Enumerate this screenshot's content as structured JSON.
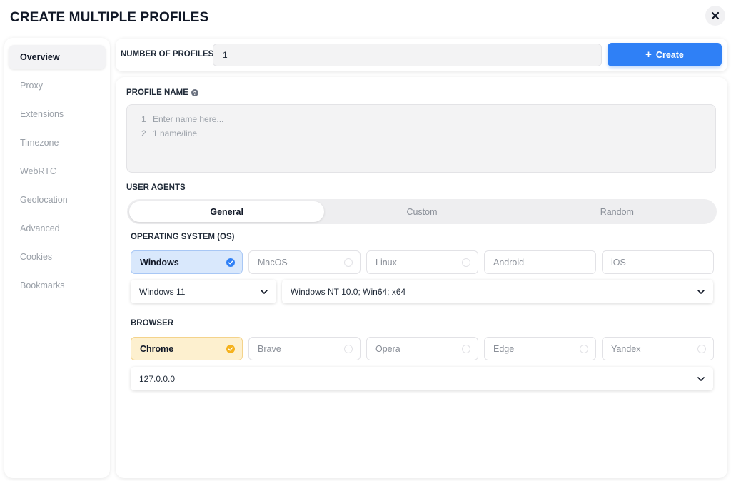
{
  "dialog": {
    "title": "CREATE MULTIPLE PROFILES"
  },
  "sidebar": {
    "items": [
      {
        "label": "Overview",
        "active": true
      },
      {
        "label": "Proxy"
      },
      {
        "label": "Extensions"
      },
      {
        "label": "Timezone"
      },
      {
        "label": "WebRTC"
      },
      {
        "label": "Geolocation"
      },
      {
        "label": "Advanced"
      },
      {
        "label": "Cookies"
      },
      {
        "label": "Bookmarks"
      }
    ]
  },
  "topbar": {
    "count_label": "NUMBER OF PROFILES",
    "count_value": "1",
    "create_label": "Create"
  },
  "profile_name": {
    "label": "PROFILE NAME",
    "line_numbers": [
      "1",
      "2"
    ],
    "placeholder_lines": [
      "Enter name here...",
      "1 name/line"
    ]
  },
  "user_agents": {
    "label": "USER AGENTS",
    "tabs": [
      "General",
      "Custom",
      "Random"
    ],
    "active_tab": "General"
  },
  "os": {
    "label": "OPERATING SYSTEM (OS)",
    "options": [
      "Windows",
      "MacOS",
      "Linux",
      "Android",
      "iOS"
    ],
    "selected": "Windows",
    "version": "Windows 11",
    "ua_string": "Windows NT 10.0; Win64; x64"
  },
  "browser": {
    "label": "BROWSER",
    "options": [
      "Chrome",
      "Brave",
      "Opera",
      "Edge",
      "Yandex"
    ],
    "selected": "Chrome",
    "version": "127.0.0.0"
  },
  "colors": {
    "accent": "#2f80f6",
    "os_selected_bg": "#d9e8fc",
    "browser_selected_bg": "#fdf0cf",
    "browser_check": "#f5b21e"
  },
  "icons": [
    "close-icon",
    "plus-icon",
    "help-icon",
    "check-icon",
    "chevron-down-icon"
  ]
}
